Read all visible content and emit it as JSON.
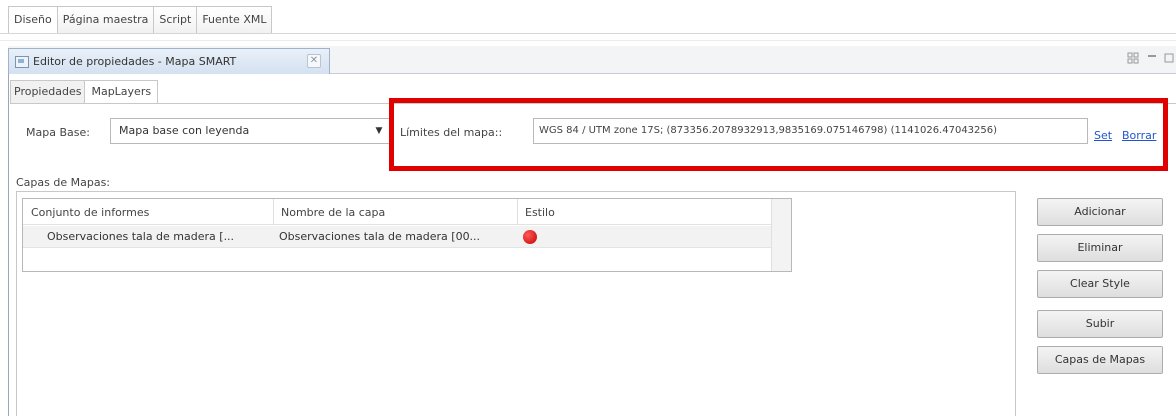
{
  "top_tabs": [
    "Diseño",
    "Página maestra",
    "Script",
    "Fuente XML"
  ],
  "view": {
    "title": "Editor de propiedades - Mapa SMART",
    "close_label": "✕"
  },
  "inner_tabs": [
    "Propiedades",
    "MapLayers"
  ],
  "map_base": {
    "label": "Mapa Base:",
    "selected": "Mapa base con leyenda"
  },
  "limits": {
    "label": "Límites del mapa::",
    "value": "WGS 84 / UTM zone 17S; (873356.2078932913,9835169.075146798) (1141026.47043256)",
    "set_link": "Set",
    "clear_link": "Borrar"
  },
  "layers": {
    "section_label": "Capas de Mapas:",
    "columns": [
      "Conjunto de informes",
      "Nombre de la capa",
      "Estilo"
    ],
    "rows": [
      {
        "report_set": "Observaciones tala de madera [...",
        "layer_name": "Observaciones tala de madera [00...",
        "style_color": "#d40000"
      }
    ]
  },
  "buttons": {
    "add": "Adicionar",
    "delete": "Eliminar",
    "clear_style": "Clear Style",
    "up": "Subir",
    "map_layers": "Capas de Mapas"
  },
  "colors": {
    "highlight": "#e00000",
    "link": "#2255cc"
  }
}
